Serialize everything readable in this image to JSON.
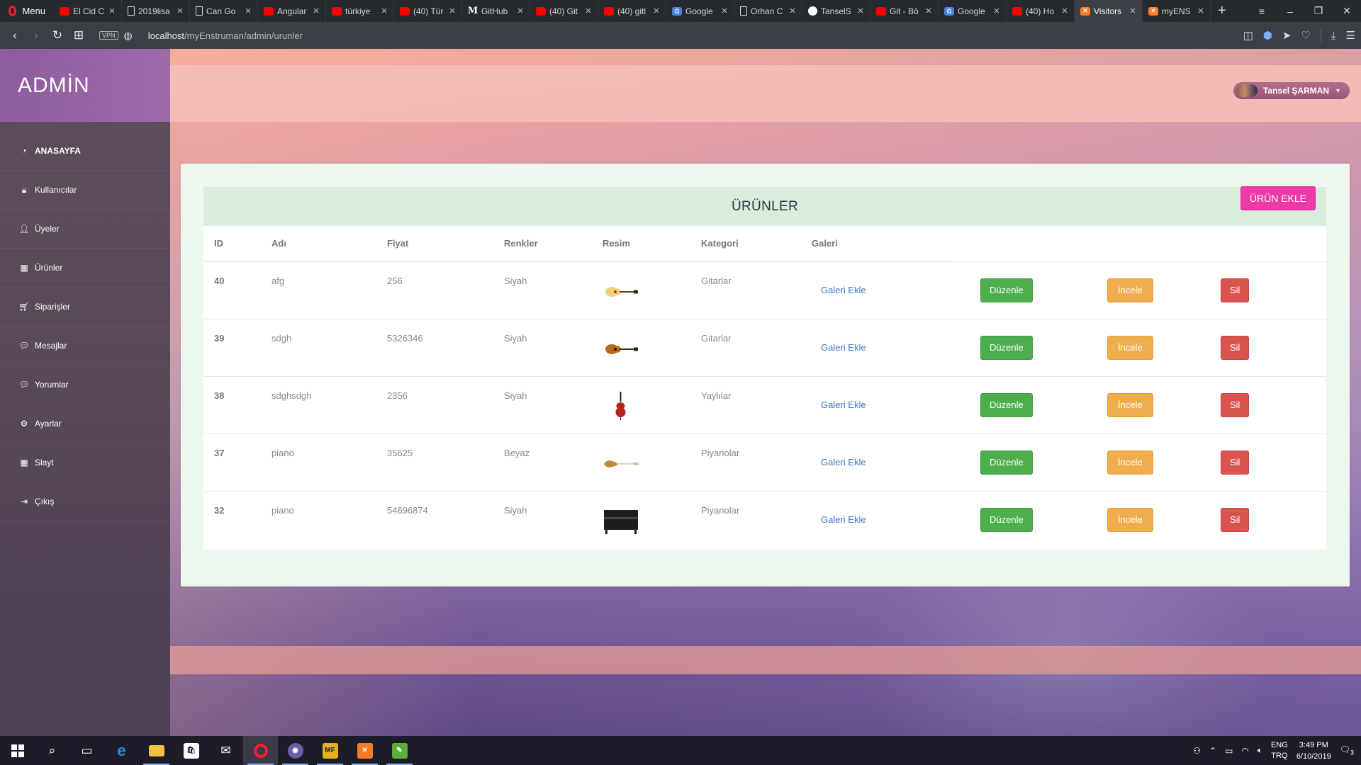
{
  "browser": {
    "menu_label": "Menu",
    "tabs": [
      {
        "title": "El Cid C",
        "favicon": "youtube-icon"
      },
      {
        "title": "2019lisa",
        "favicon": "document-icon"
      },
      {
        "title": "Can Go",
        "favicon": "document-icon"
      },
      {
        "title": "Angular",
        "favicon": "youtube-icon"
      },
      {
        "title": "türkiye",
        "favicon": "youtube-icon"
      },
      {
        "title": "(40) Tür",
        "favicon": "youtube-icon"
      },
      {
        "title": "GitHub",
        "favicon": "medium-icon"
      },
      {
        "title": "(40) Git",
        "favicon": "youtube-icon"
      },
      {
        "title": "(40) gitl",
        "favicon": "youtube-icon"
      },
      {
        "title": "Google",
        "favicon": "google-translate-icon"
      },
      {
        "title": "Orhan C",
        "favicon": "document-icon"
      },
      {
        "title": "TanselS",
        "favicon": "github-icon"
      },
      {
        "title": "Git - Bö",
        "favicon": "youtube-icon"
      },
      {
        "title": "Google",
        "favicon": "google-translate-icon"
      },
      {
        "title": "(40) Ho",
        "favicon": "youtube-icon"
      },
      {
        "title": "Visitors",
        "favicon": "xampp-icon",
        "active": true
      },
      {
        "title": "myENS",
        "favicon": "xampp-icon"
      }
    ],
    "vpn_label": "VPN",
    "url_host": "localhost",
    "url_path": "/myEnstruman/admin/urunler"
  },
  "sidebar": {
    "brand": "ADMİN",
    "items": [
      {
        "label": "ANASAYFA",
        "icon": "dashboard-icon"
      },
      {
        "label": "Kullanıcılar",
        "icon": "lock-icon"
      },
      {
        "label": "Üyeler",
        "icon": "user-icon"
      },
      {
        "label": "Ürünler",
        "icon": "grid-icon"
      },
      {
        "label": "Siparişler",
        "icon": "cart-icon"
      },
      {
        "label": "Mesajlar",
        "icon": "comment-icon"
      },
      {
        "label": "Yorumlar",
        "icon": "comment-icon"
      },
      {
        "label": "Ayarlar",
        "icon": "gear-icon"
      },
      {
        "label": "Slayt",
        "icon": "grid-icon"
      },
      {
        "label": "Çıkış",
        "icon": "sign-out-icon"
      }
    ]
  },
  "header": {
    "user_name": "Tansel ŞARMAN"
  },
  "products_panel": {
    "title": "ÜRÜNLER",
    "add_button": "ÜRÜN EKLE",
    "columns": [
      "ID",
      "Adı",
      "Fiyat",
      "Renkler",
      "Resim",
      "Kategori",
      "Galeri"
    ],
    "rows": [
      {
        "id": "40",
        "name": "afg",
        "price": "256",
        "color": "Siyah",
        "image": "acoustic-guitar-light",
        "category": "Gitarlar",
        "gallery": "Galeri Ekle",
        "edit": "Düzenle",
        "view": "İncele",
        "delete": "Sil"
      },
      {
        "id": "39",
        "name": "sdgh",
        "price": "5326346",
        "color": "Siyah",
        "image": "acoustic-guitar-brown",
        "category": "Gitarlar",
        "gallery": "Galeri Ekle",
        "edit": "Düzenle",
        "view": "İncele",
        "delete": "Sil"
      },
      {
        "id": "38",
        "name": "sdghsdgh",
        "price": "2356",
        "color": "Siyah",
        "image": "cello",
        "category": "Yaylılar",
        "gallery": "Galeri Ekle",
        "edit": "Düzenle",
        "view": "İncele",
        "delete": "Sil"
      },
      {
        "id": "37",
        "name": "piano",
        "price": "35625",
        "color": "Beyaz",
        "image": "electric-guitar",
        "category": "Piyanolar",
        "gallery": "Galeri Ekle",
        "edit": "Düzenle",
        "view": "İncele",
        "delete": "Sil"
      },
      {
        "id": "32",
        "name": "piano",
        "price": "54696874",
        "color": "Siyah",
        "image": "upright-piano",
        "category": "Piyanolar",
        "gallery": "Galeri Ekle",
        "edit": "Düzenle",
        "view": "İncele",
        "delete": "Sil"
      }
    ]
  },
  "taskbar": {
    "apps": [
      "start-icon",
      "search-icon",
      "task-view-icon",
      "edge-icon",
      "file-explorer-icon",
      "store-icon",
      "mail-icon",
      "opera-icon",
      "app-icon",
      "mf-icon",
      "xampp-icon",
      "notepad-icon"
    ],
    "mf_label": "MF",
    "lang_top": "ENG",
    "lang_bottom": "TRQ",
    "time": "3:49 PM",
    "date": "6/10/2019",
    "notifications": "3"
  },
  "colors": {
    "brand_purple": "#a06aa9",
    "add_pink": "#ee3aa6",
    "edit_green": "#4cae4c",
    "view_orange": "#f0ad4e",
    "delete_red": "#d9534f",
    "link_blue": "#3a78c3"
  }
}
